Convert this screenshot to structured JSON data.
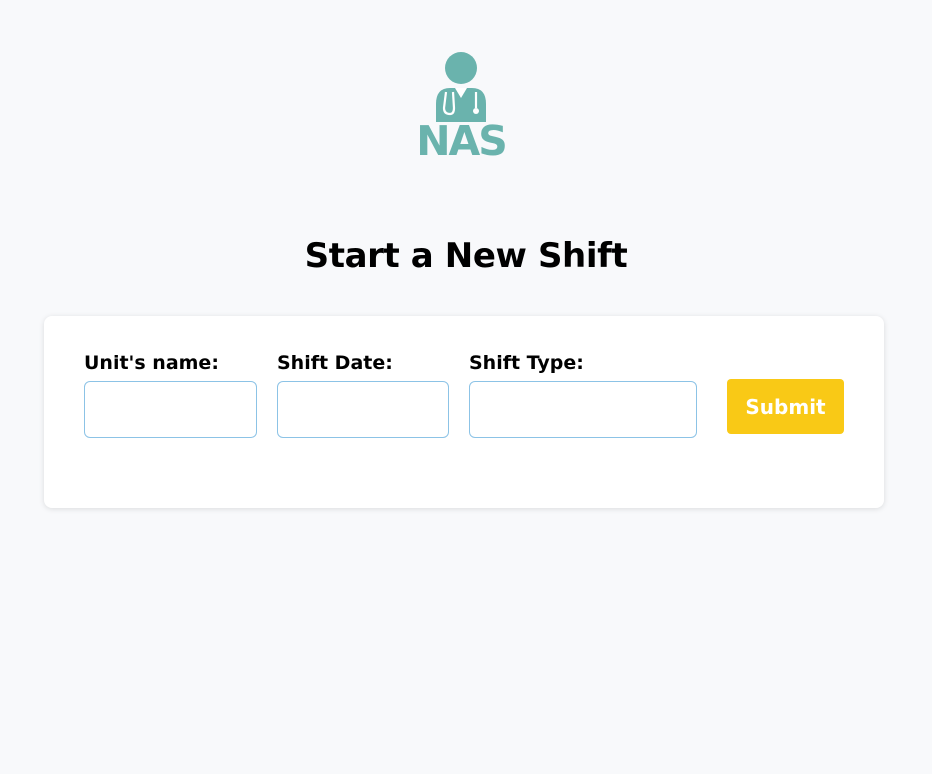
{
  "logo": {
    "text": "NAS",
    "icon": "nurse-icon",
    "color": "#6ab3ad"
  },
  "page": {
    "title": "Start a New Shift"
  },
  "form": {
    "fields": [
      {
        "label": "Unit's name:",
        "value": "",
        "placeholder": ""
      },
      {
        "label": "Shift Date:",
        "value": "",
        "placeholder": ""
      },
      {
        "label": "Shift Type:",
        "value": "",
        "placeholder": ""
      }
    ],
    "submit_label": "Submit"
  },
  "colors": {
    "background": "#f8f9fb",
    "card": "#ffffff",
    "input_border": "#8cc3e6",
    "submit": "#f9c916",
    "submit_text": "#ffffff"
  }
}
